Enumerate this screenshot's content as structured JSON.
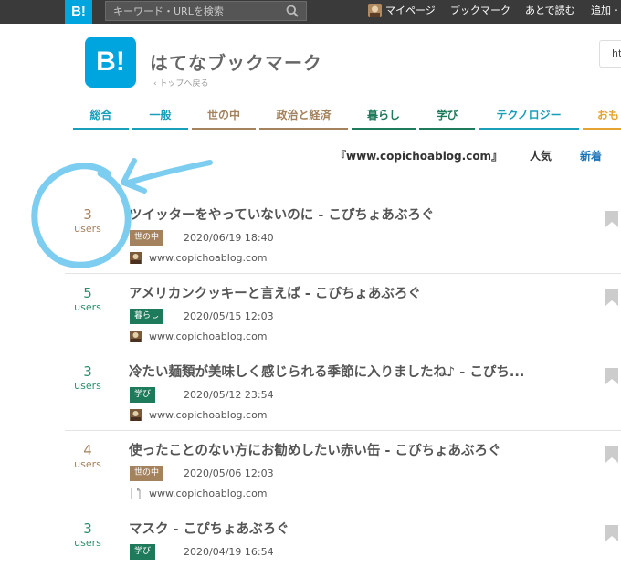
{
  "topbar": {
    "logo": "B!",
    "search_placeholder": "キーワード・URLを検索",
    "nav": [
      "マイページ",
      "ブックマーク",
      "あとで読む",
      "追加・"
    ]
  },
  "header": {
    "logo": "B!",
    "title": "はてなブックマーク",
    "back": "トップへ戻る",
    "right_partial": "ht"
  },
  "tabs": [
    {
      "label": "総合",
      "color": "#1a9fbb"
    },
    {
      "label": "一般",
      "color": "#1a9fbb"
    },
    {
      "label": "世の中",
      "color": "#a5825e"
    },
    {
      "label": "政治と経済",
      "color": "#a5825e"
    },
    {
      "label": "暮らし",
      "color": "#1d7a5a"
    },
    {
      "label": "学び",
      "color": "#1d7a5a"
    },
    {
      "label": "テクノロジー",
      "color": "#1a9fbb"
    },
    {
      "label": "おも",
      "color": "#e5a432"
    }
  ],
  "filter": {
    "domain": "『www.copichoablog.com』",
    "sort_popular": "人気",
    "sort_new": "新着"
  },
  "entries": [
    {
      "users": "3",
      "users_label": "users",
      "title": "ツイッターをやっていないのに - こぴちょあぶろぐ",
      "category": "世の中",
      "category_color": "#a5825e",
      "date": "2020/06/19 18:40",
      "site": "www.copichoablog.com",
      "favicon": "avatar-icon",
      "count_color": "brown"
    },
    {
      "users": "5",
      "users_label": "users",
      "title": "アメリカンクッキーと言えば - こぴちょあぶろぐ",
      "category": "暮らし",
      "category_color": "#1d7a5a",
      "date": "2020/05/15 12:03",
      "site": "www.copichoablog.com",
      "favicon": "avatar-icon",
      "count_color": "green"
    },
    {
      "users": "3",
      "users_label": "users",
      "title": "冷たい麺類が美味しく感じられる季節に入りましたね♪ - こぴち...",
      "category": "学び",
      "category_color": "#1d7a5a",
      "date": "2020/05/12 23:54",
      "site": "www.copichoablog.com",
      "favicon": "avatar-icon",
      "count_color": "green"
    },
    {
      "users": "4",
      "users_label": "users",
      "title": "使ったことのない方にお勧めしたい赤い缶 - こぴちょあぶろぐ",
      "category": "世の中",
      "category_color": "#a5825e",
      "date": "2020/05/06 12:03",
      "site": "www.copichoablog.com",
      "favicon": "document-icon",
      "count_color": "brown"
    },
    {
      "users": "3",
      "users_label": "users",
      "title": "マスク - こぴちょあぶろぐ",
      "category": "学び",
      "category_color": "#1d7a5a",
      "date": "2020/04/19 16:54",
      "site": "",
      "favicon": "",
      "count_color": "green"
    }
  ],
  "annotation": {
    "color": "#7ccdf0",
    "shape": "hand-drawn circle with arrow"
  }
}
